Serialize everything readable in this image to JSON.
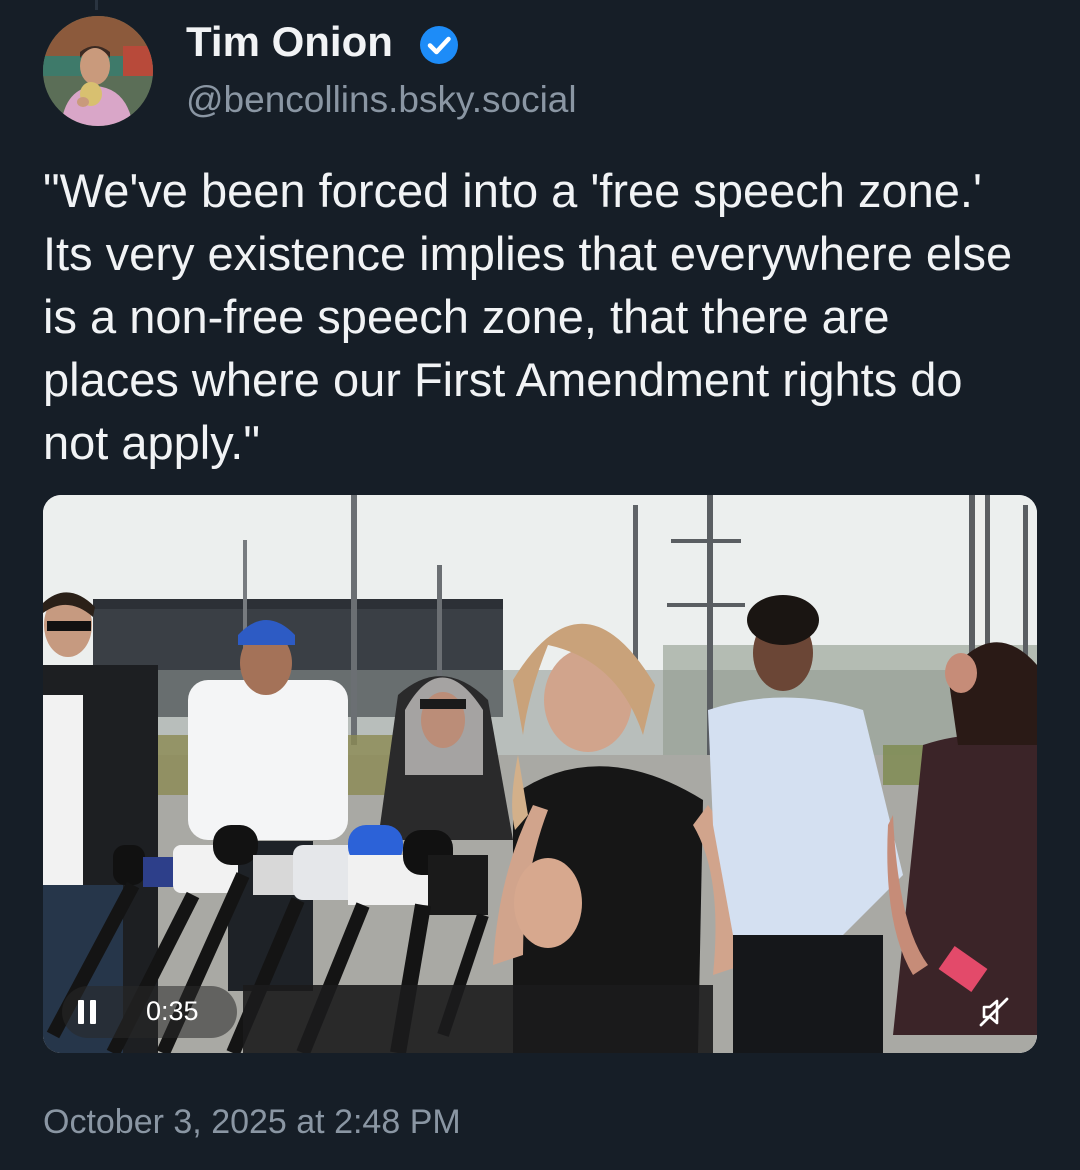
{
  "post": {
    "author_name": "Tim Onion",
    "verified_icon": "verified-check-icon",
    "handle": "@bencollins.bsky.social",
    "text": "\"We've been forced into a 'free speech zone.' Its very existence implies that everywhere else is a non-free speech zone, that there are places where our First Amendment rights do not apply.\"",
    "timestamp": "October 3, 2025 at 2:48 PM"
  },
  "video": {
    "elapsed": "0:35",
    "play_state_icon": "pause-icon",
    "mute_icon": "muted-speaker-icon"
  },
  "colors": {
    "background": "#161e27",
    "text_primary": "#f1f3f5",
    "text_secondary": "#8a96a3",
    "verified_blue": "#1d8cf8"
  }
}
